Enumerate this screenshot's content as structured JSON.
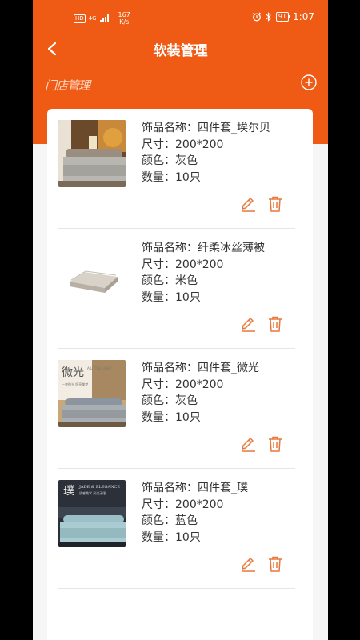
{
  "status_bar": {
    "hd": "HD",
    "network": "4G",
    "speed_value": "167",
    "speed_unit": "K/s",
    "battery": "91",
    "time": "1:07"
  },
  "header": {
    "title": "软装管理",
    "store_label": "门店管理"
  },
  "colors": {
    "accent": "#ef5a14",
    "icon_orange": "#e8773a"
  },
  "items": [
    {
      "name": "饰品名称：四件套_埃尔贝",
      "size": "尺寸：200*200",
      "color": "颜色：灰色",
      "qty": "数量：10只"
    },
    {
      "name": "饰品名称：纤柔冰丝薄被",
      "size": "尺寸：200*200",
      "color": "颜色：米色",
      "qty": "数量：10只"
    },
    {
      "name": "饰品名称：四件套_微光",
      "size": "尺寸：200*200",
      "color": "颜色：灰色",
      "qty": "数量：10只"
    },
    {
      "name": "饰品名称：四件套_璞",
      "size": "尺寸：200*200",
      "color": "颜色：蓝色",
      "qty": "数量：10只"
    }
  ],
  "thumb_text": {
    "item3_cn": "微光",
    "item3_en": "A LITTLE LIGHT",
    "item3_sub": "一束微光 照亮美梦",
    "item4_cn": "璞",
    "item4_en": "JADE & ELEGANCE",
    "item4_sub": "质感美学 风尚无限"
  }
}
